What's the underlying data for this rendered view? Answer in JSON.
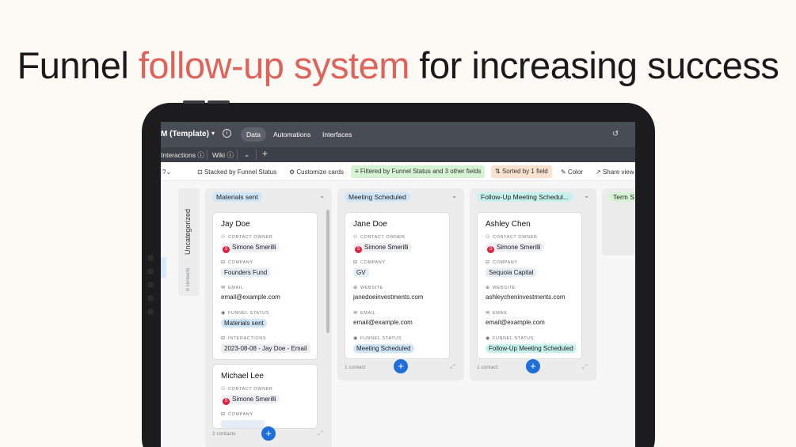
{
  "headline": {
    "part1": "Funnel ",
    "accent": "follow-up system",
    "part2": " for increasing success"
  },
  "app": {
    "title": "M (Template)",
    "tabs": [
      "Data",
      "Automations",
      "Interfaces"
    ],
    "subbar": {
      "interactions": "Interactions",
      "wiki": "Wiki"
    }
  },
  "toolbar": {
    "stacked": "Stacked by Funnel Status",
    "customize": "Customize cards",
    "filtered": "Filtered by Funnel Status and 3 other fields",
    "sorted": "Sorted by 1 field",
    "color": "Color",
    "share": "Share view"
  },
  "uncategorized": {
    "label": "Uncategorized",
    "count": "0 contacts"
  },
  "labels": {
    "contact_owner": "CONTACT OWNER",
    "company": "COMPANY",
    "email": "EMAIL",
    "website": "WEBSITE",
    "funnel_status": "FUNNEL STATUS",
    "interactions": "INTERACTIONS"
  },
  "columns": [
    {
      "title": "Materials sent",
      "color": "#cfe5f8",
      "footer": "2 contacts",
      "cards": [
        {
          "name": "Jay Doe",
          "owner": "Simone Smerilli",
          "company": "Founders Fund",
          "email": "email@example.com",
          "status": "Materials sent",
          "interaction": "2023-08-08 - Jay Doe - Email"
        },
        {
          "name": "Michael Lee",
          "owner": "Simone Smerilli"
        }
      ]
    },
    {
      "title": "Meeting Scheduled",
      "color": "#cfe5f8",
      "footer": "1 contact",
      "cards": [
        {
          "name": "Jane Doe",
          "owner": "Simone Smerilli",
          "company": "GV",
          "website": "janedoeinvestments.com",
          "email": "email@example.com",
          "status": "Meeting Scheduled"
        }
      ]
    },
    {
      "title": "Follow-Up Meeting Schedul...",
      "color": "#c7f1ec",
      "footer": "1 contact",
      "cards": [
        {
          "name": "Ashley Chen",
          "owner": "Simone Smerilli",
          "company": "Sequoia Capital",
          "website": "ashleycheninvestments.com",
          "email": "email@example.com",
          "status": "Follow-Up Meeting Scheduled"
        }
      ]
    },
    {
      "title": "Term S",
      "color": "#d6f3d4"
    }
  ],
  "avatar_initial": "S"
}
